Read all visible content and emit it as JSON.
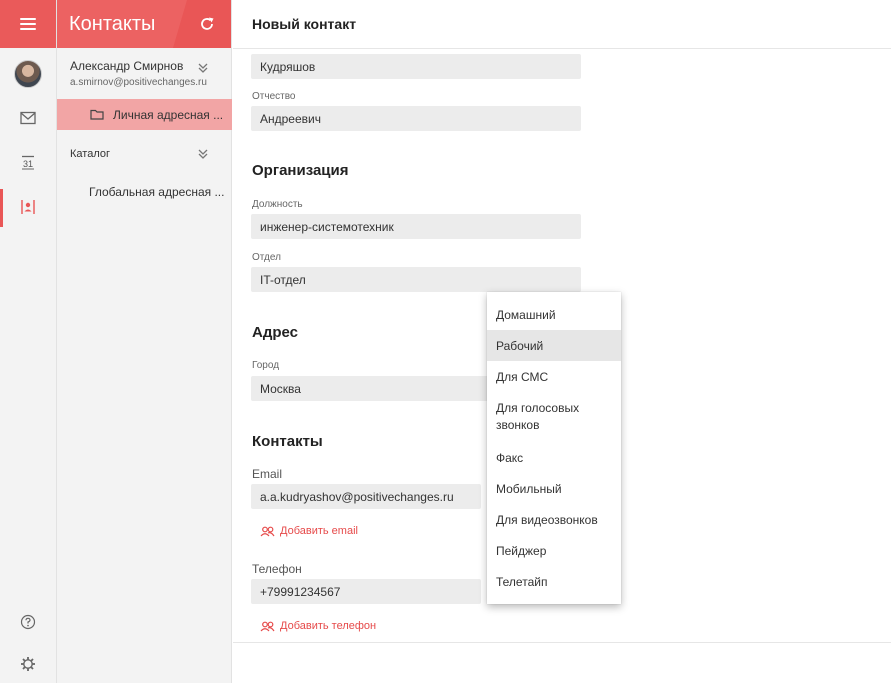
{
  "app": {
    "title": "Контакты"
  },
  "folders": {
    "account_name": "Александр Смирнов",
    "account_email": "a.smirnov@positivechanges.ru",
    "personal_book": "Личная адресная ...",
    "catalog": "Каталог",
    "global_book": "Глобальная адресная ..."
  },
  "main": {
    "title": "Новый контакт",
    "last_name_value": "Кудряшов",
    "patronymic_label": "Отчество",
    "patronymic_value": "Андреевич",
    "org_section": "Организация",
    "position_label": "Должность",
    "position_value": "инженер-системотехник",
    "department_label": "Отдел",
    "department_value": "IT-отдел",
    "address_section": "Адрес",
    "city_label": "Город",
    "city_value": "Москва",
    "contacts_section": "Контакты",
    "email_label": "Email",
    "email_value": "a.a.kudryashov@positivechanges.ru",
    "add_email": "Добавить email",
    "phone_label": "Телефон",
    "phone_value": "+79991234567",
    "add_phone": "Добавить телефон"
  },
  "phone_type_menu": {
    "items": [
      "Домашний",
      "Рабочий",
      "Для СМС",
      "Для голосовых звонков",
      "Факс",
      "Мобильный",
      "Для видеозвонков",
      "Пейджер",
      "Телетайп"
    ],
    "highlighted": "Рабочий"
  },
  "colors": {
    "accent": "#e95656",
    "selection": "#f2a5a5",
    "field_bg": "#ececec"
  },
  "icons": {
    "menu": "hamburger-icon",
    "refresh": "refresh-icon",
    "mail": "mail-icon",
    "calendar": "calendar-icon",
    "contacts": "contacts-icon",
    "help": "help-icon",
    "settings": "gear-icon"
  }
}
